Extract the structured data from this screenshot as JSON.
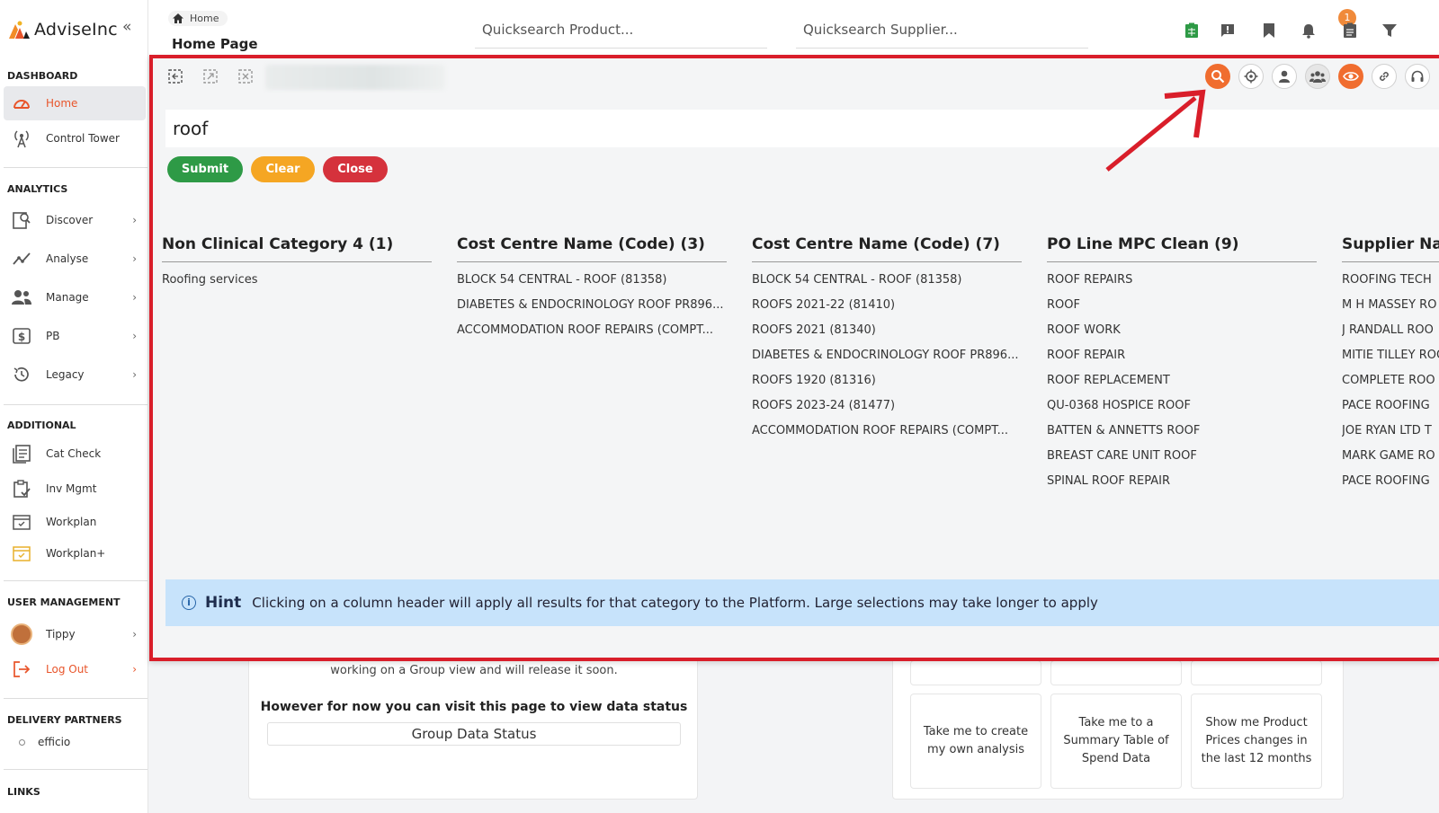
{
  "brand": {
    "name": "AdviseInc",
    "collapse_glyph": "«"
  },
  "sidebar": {
    "sections": {
      "dashboard": "DASHBOARD",
      "analytics": "ANALYTICS",
      "additional": "ADDITIONAL",
      "user_management": "USER MANAGEMENT",
      "delivery_partners": "DELIVERY PARTNERS",
      "links": "LINKS"
    },
    "dashboard_items": [
      {
        "label": "Home",
        "icon": "gauge-icon",
        "active": true
      },
      {
        "label": "Control Tower",
        "icon": "antenna-icon"
      }
    ],
    "analytics_items": [
      {
        "label": "Discover",
        "icon": "discover-icon"
      },
      {
        "label": "Analyse",
        "icon": "analyse-icon"
      },
      {
        "label": "Manage",
        "icon": "users-icon"
      },
      {
        "label": "PB",
        "icon": "dollar-icon"
      },
      {
        "label": "Legacy",
        "icon": "history-icon"
      }
    ],
    "additional_items": [
      {
        "label": "Cat Check",
        "icon": "catalog-icon"
      },
      {
        "label": "Inv Mgmt",
        "icon": "clipboard-check-icon"
      },
      {
        "label": "Workplan",
        "icon": "calendar-icon"
      },
      {
        "label": "Workplan+",
        "icon": "calendar-plus-icon"
      }
    ],
    "user_items": [
      {
        "label": "Tippy",
        "icon": "avatar"
      },
      {
        "label": "Log Out",
        "icon": "logout-icon"
      }
    ],
    "partners": [
      {
        "label": "efficio"
      }
    ]
  },
  "topbar": {
    "breadcrumb": "Home",
    "page_title": "Home Page",
    "quicksearch_product": "Quicksearch Product...",
    "quicksearch_supplier": "Quicksearch Supplier...",
    "notification_count": "1",
    "icons": [
      "spreadsheet-icon",
      "feedback-icon",
      "bookmark-icon",
      "bell-icon",
      "clipboard-icon",
      "filter-icon"
    ]
  },
  "background": {
    "partial_text": "working on a Group view and will release it soon.",
    "bold_text": "However for now you can visit this page to view data status",
    "group_button": "Group Data Status",
    "quick_actions": [
      "Take me to create my own analysis",
      "Take me to a Summary Table of Spend Data",
      "Show me Product Prices changes in the last 12 months"
    ]
  },
  "search": {
    "query": "roof",
    "submit": "Submit",
    "clear": "Clear",
    "close": "Close",
    "toolbar_icons": [
      "select-area-icon",
      "export-selection-icon",
      "clear-selection-icon"
    ],
    "right_icons": [
      "search-icon",
      "target-icon",
      "user-icon",
      "group-icon",
      "eye-icon",
      "link-icon",
      "headset-icon"
    ],
    "columns": [
      {
        "header": "Non Clinical Category 4 (1)",
        "items": [
          "Roofing services"
        ]
      },
      {
        "header": "Cost Centre Name (Code) (3)",
        "items": [
          "BLOCK 54 CENTRAL - ROOF (81358)",
          "DIABETES & ENDOCRINOLOGY ROOF PR896...",
          "ACCOMMODATION ROOF REPAIRS (COMPT..."
        ]
      },
      {
        "header": "Cost Centre Name (Code) (7)",
        "items": [
          "BLOCK 54 CENTRAL - ROOF (81358)",
          "ROOFS 2021-22 (81410)",
          "ROOFS 2021 (81340)",
          "DIABETES & ENDOCRINOLOGY ROOF PR896...",
          "ROOFS 1920 (81316)",
          "ROOFS 2023-24 (81477)",
          "ACCOMMODATION ROOF REPAIRS (COMPT..."
        ]
      },
      {
        "header": "PO Line MPC Clean (9)",
        "items": [
          "ROOF REPAIRS",
          "ROOF",
          "ROOF WORK",
          "ROOF REPAIR",
          "ROOF REPLACEMENT",
          "QU-0368 HOSPICE ROOF",
          "BATTEN & ANNETTS ROOF",
          "BREAST CARE UNIT ROOF",
          "SPINAL ROOF REPAIR"
        ]
      },
      {
        "header": "Supplier Na",
        "items": [
          "ROOFING TECH",
          "M H MASSEY RO",
          "J RANDALL ROO",
          "MITIE TILLEY ROO",
          "COMPLETE ROO",
          "PACE ROOFING",
          "JOE RYAN LTD T",
          "MARK GAME RO",
          "PACE ROOFING"
        ]
      }
    ],
    "hint_title": "Hint",
    "hint_text": "Clicking on a column header will apply all results for that category to the Platform. Large selections may take longer to apply"
  },
  "colors": {
    "accent": "#f06d2f",
    "submit": "#2e9a46",
    "clear": "#f5a623",
    "close": "#d5323c",
    "highlight_border": "#d91e2a",
    "hint_bg": "#c7e3fb"
  }
}
